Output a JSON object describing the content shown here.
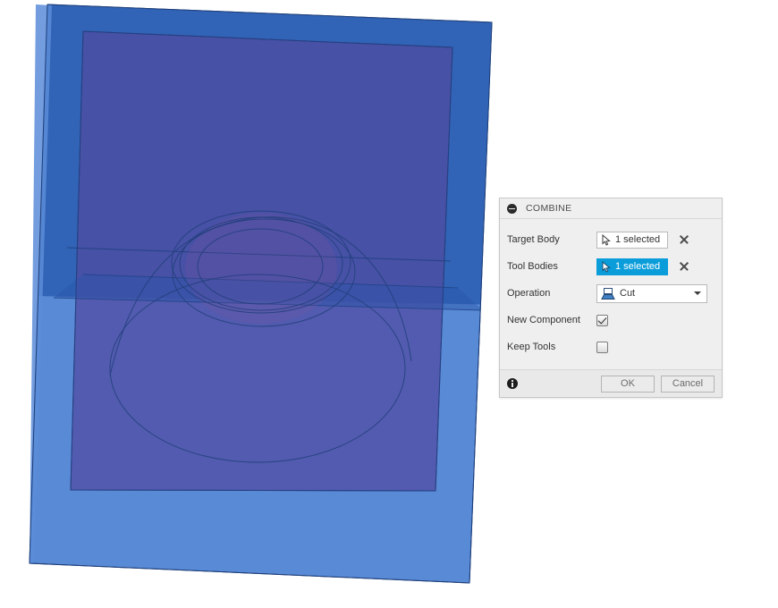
{
  "app": {
    "background_color": "#ffffff"
  },
  "viewport": {
    "name": "cad-3d-viewport",
    "description": "CAD 3D viewport with two translucent blue bodies and elliptical sketch curves",
    "colors": {
      "outer_body": "#3a6fbe",
      "outer_body_light": "#4a7fd0",
      "inner_body": "#4a4f9e",
      "inner_body_purple": "#5b55a5",
      "edge_line": "#1f3f7a",
      "highlight_band": "#2f5fb0"
    }
  },
  "dialog": {
    "title": "COMBINE",
    "collapse_icon": "minus-circle-icon",
    "rows": [
      {
        "label": "Target Body",
        "field_type": "selection",
        "field_value": "1 selected",
        "field_icon": "select-cursor-icon",
        "active": false,
        "clear_icon": "close-x-icon"
      },
      {
        "label": "Tool Bodies",
        "field_type": "selection",
        "field_value": "1 selected",
        "field_icon": "select-cursor-icon",
        "active": true,
        "clear_icon": "close-x-icon"
      },
      {
        "label": "Operation",
        "field_type": "dropdown",
        "field_value": "Cut",
        "field_icon": "cut-operation-icon",
        "arrow_icon": "chevron-down-icon"
      },
      {
        "label": "New Component",
        "field_type": "checkbox",
        "checked": true
      },
      {
        "label": "Keep Tools",
        "field_type": "checkbox",
        "checked": false
      }
    ],
    "footer": {
      "info_icon": "info-icon",
      "ok_label": "OK",
      "cancel_label": "Cancel"
    },
    "accent_color": "#0b9dda",
    "panel_color": "#efefef"
  }
}
